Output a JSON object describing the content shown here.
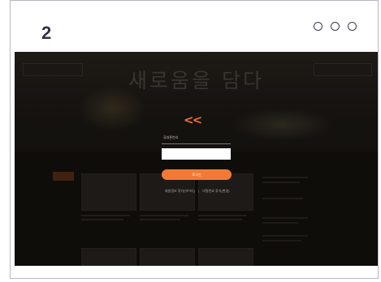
{
  "step": {
    "number": "2"
  },
  "window_controls": [
    "circle-1",
    "circle-2",
    "circle-3"
  ],
  "screenshot": {
    "hero_title": "새로움을 담다",
    "login": {
      "id_label": "휴대폰번호",
      "id_value": "",
      "button_label": "로그인",
      "link_left": "회원정보 찾기(아이디)",
      "link_separator": "|",
      "link_right": "비밀번호 찾기(변경)"
    }
  },
  "colors": {
    "accent": "#f27a36",
    "card_border": "#b9b5c6",
    "dim_bg": "#171412"
  }
}
